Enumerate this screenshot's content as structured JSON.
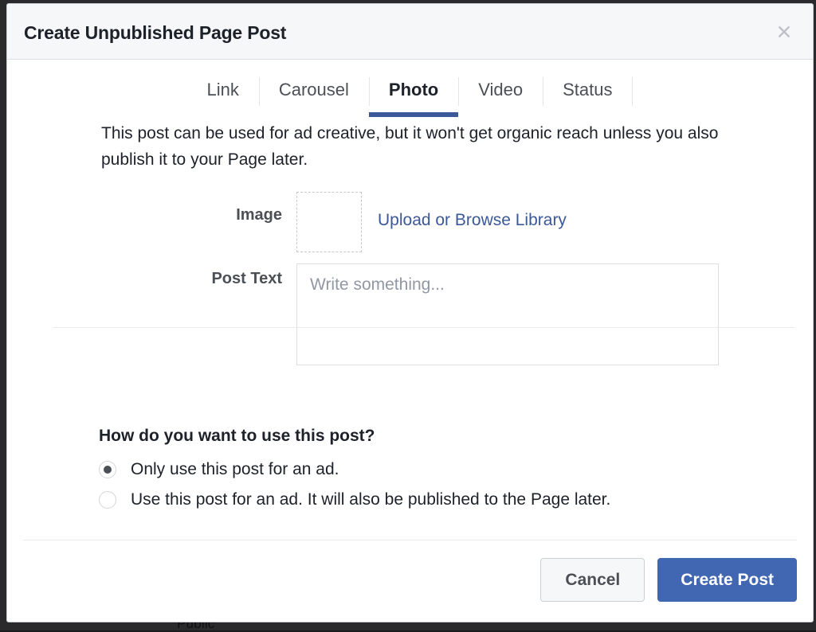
{
  "backdrop": {
    "partial_text": "Public"
  },
  "modal": {
    "title": "Create Unpublished Page Post",
    "close_icon": "close-icon",
    "close_glyph": "✕",
    "tabs": [
      {
        "label": "Link",
        "active": false
      },
      {
        "label": "Carousel",
        "active": false
      },
      {
        "label": "Photo",
        "active": true
      },
      {
        "label": "Video",
        "active": false
      },
      {
        "label": "Status",
        "active": false
      }
    ],
    "intro_text": "This post can be used for ad creative, but it won't get organic reach unless you also publish it to your Page later.",
    "form": {
      "image_label": "Image",
      "image_dropzone_name": "image-dropzone",
      "upload_link": "Upload or Browse Library",
      "post_text_label": "Post Text",
      "post_text_value": "",
      "post_text_placeholder": "Write something..."
    },
    "usage": {
      "question": "How do you want to use this post?",
      "options": [
        {
          "label": "Only use this post for an ad.",
          "selected": true
        },
        {
          "label": "Use this post for an ad. It will also be published to the Page later.",
          "selected": false
        }
      ]
    },
    "footer": {
      "cancel_label": "Cancel",
      "create_label": "Create Post"
    }
  },
  "colors": {
    "accent_blue": "#4267b2",
    "tab_underline": "#3b5998",
    "link_blue": "#3b5998",
    "header_bg": "#f6f7f9",
    "text_dark": "#1d2129",
    "text_muted": "#4b4f56",
    "placeholder": "#9197a3"
  }
}
